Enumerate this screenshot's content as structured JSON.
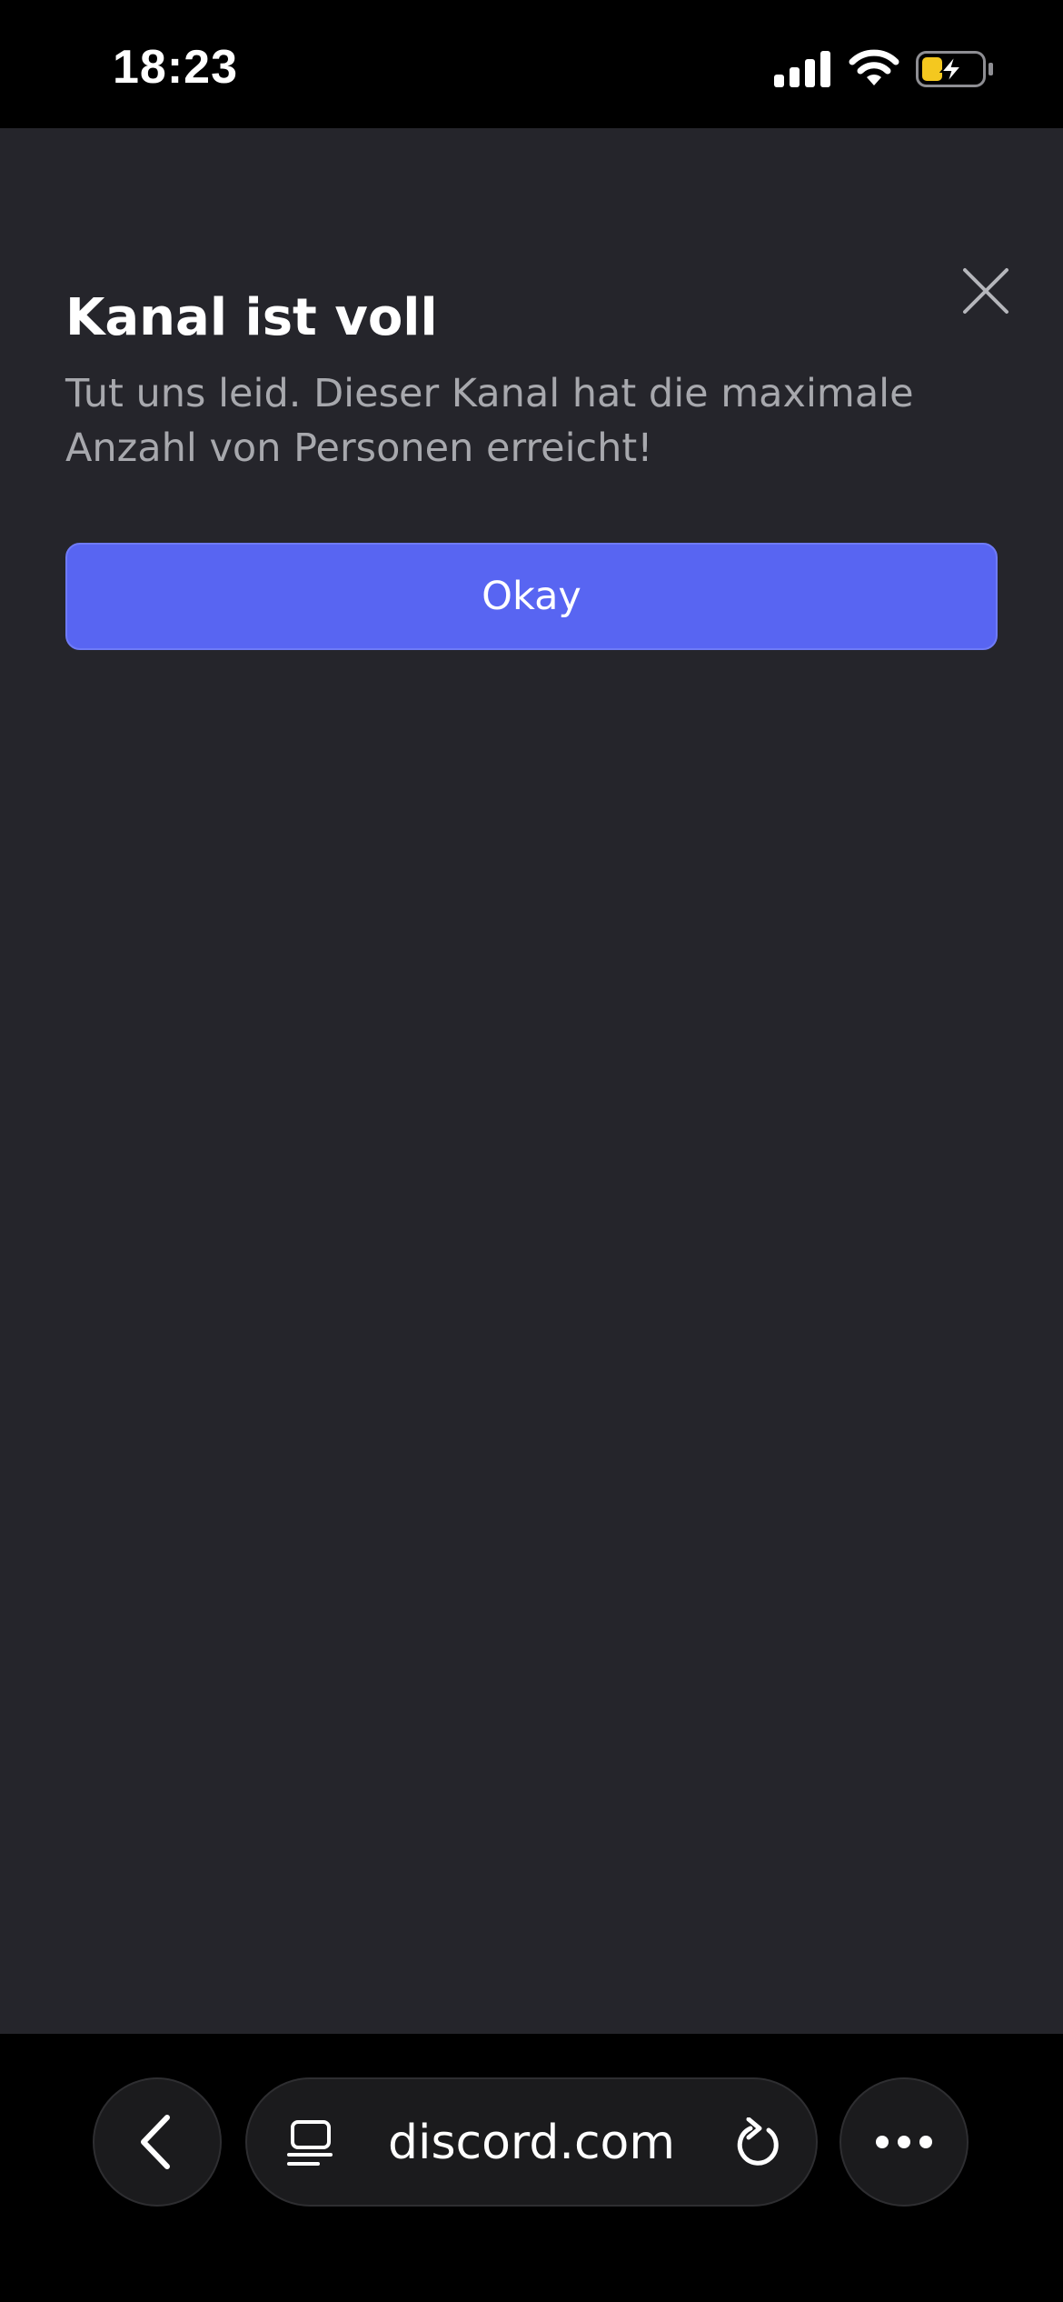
{
  "status_bar": {
    "time": "18:23",
    "battery_color": "#f4c81f"
  },
  "modal": {
    "title": "Kanal ist voll",
    "body": "Tut uns leid. Dieser Kanal hat die maximale Anzahl von Personen erreicht!",
    "okay_label": "Okay",
    "accent_color": "#5865f2"
  },
  "browser": {
    "url": "discord.com",
    "icons": [
      "back-icon",
      "tabs-icon",
      "reload-icon",
      "more-icon"
    ]
  }
}
